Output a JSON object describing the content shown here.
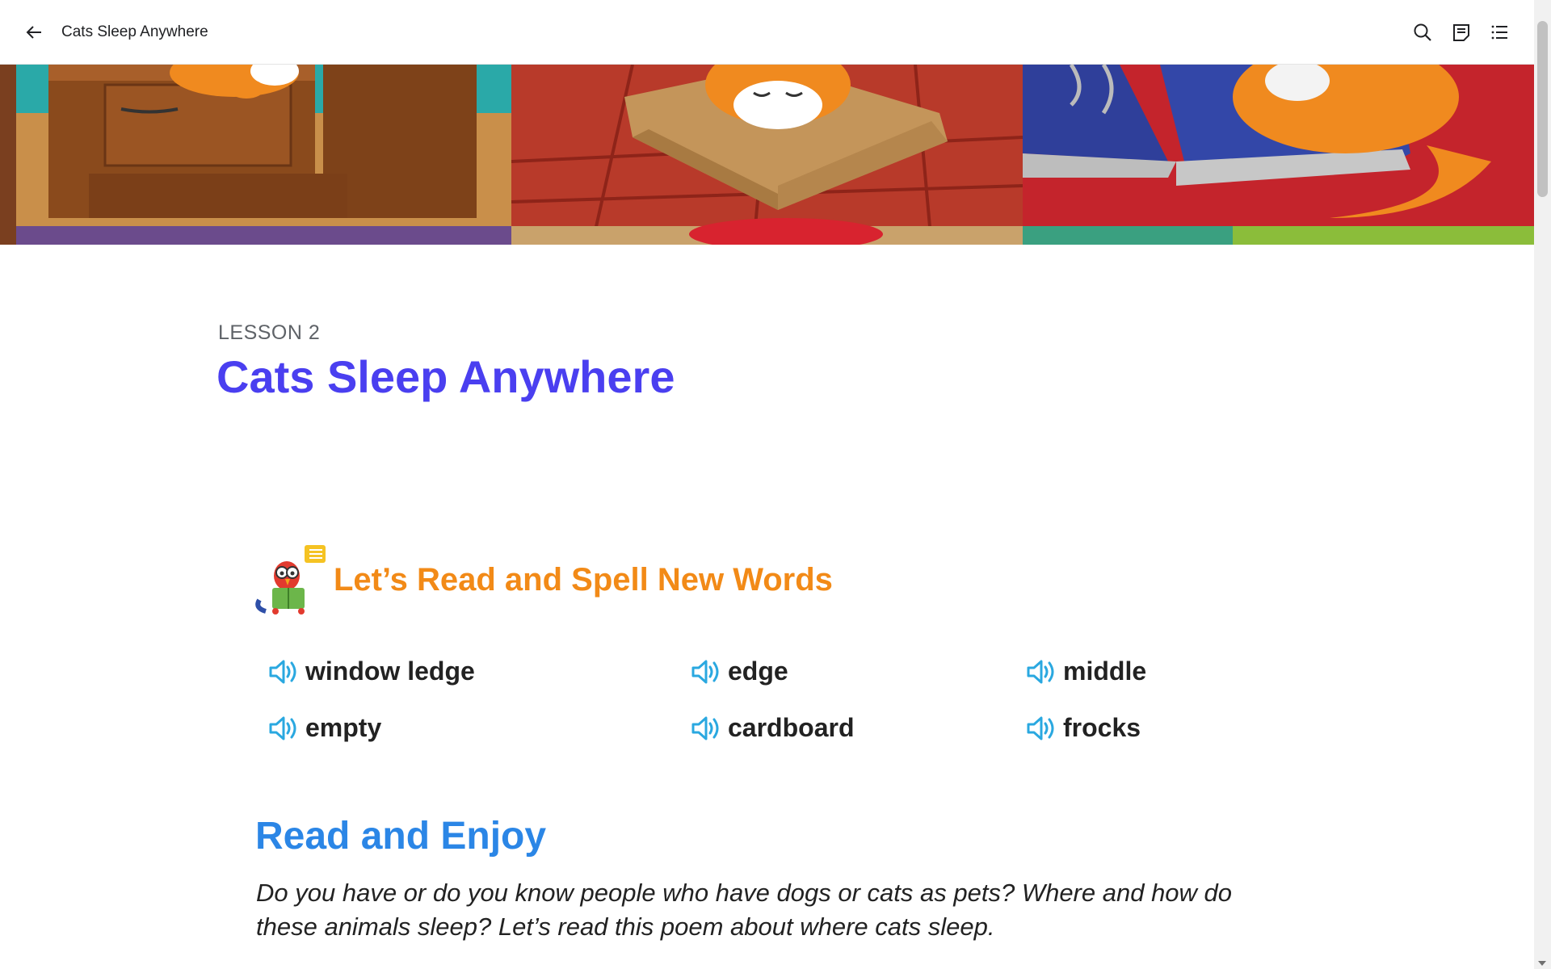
{
  "topbar": {
    "title": "Cats Sleep Anywhere",
    "icons": [
      "back-arrow-icon",
      "search-icon",
      "notes-icon",
      "table-of-contents-icon"
    ]
  },
  "lesson": {
    "label": "LESSON 2",
    "title": "Cats Sleep Anywhere"
  },
  "vocabulary": {
    "heading": "Let’s Read and Spell New Words",
    "words": [
      "window ledge",
      "edge",
      "middle",
      "empty",
      "cardboard",
      "frocks"
    ]
  },
  "reading": {
    "heading": "Read and Enjoy",
    "intro": "Do you have or do you know people who have dogs or cats as pets? Where and how do these animals sleep? Let’s read this poem about where cats sleep."
  },
  "colors": {
    "lesson_title": "#4a3ff0",
    "section_title": "#f28a17",
    "read_title": "#2b86e6",
    "speaker": "#2aa8e0"
  }
}
